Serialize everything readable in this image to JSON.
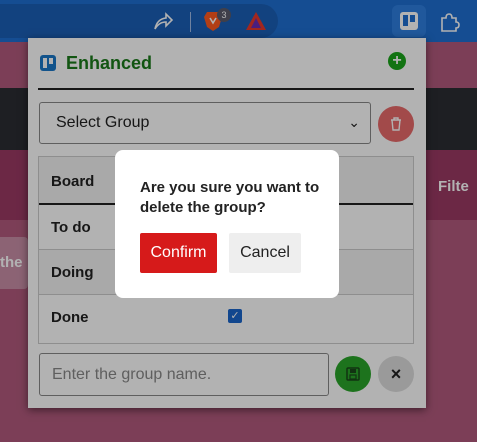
{
  "browser": {
    "badge_count": "3",
    "icons": [
      "share-icon",
      "brave-icon",
      "triangle-icon",
      "trello-icon",
      "puzzle-icon"
    ]
  },
  "page": {
    "filter_text": "Filte",
    "other_text": "the"
  },
  "popup": {
    "title": "Enhanced",
    "group_select": "Select Group",
    "table_header": "Board",
    "rows": [
      {
        "label": "To do",
        "checked": false
      },
      {
        "label": "Doing",
        "checked": false
      },
      {
        "label": "Done",
        "checked": true
      }
    ],
    "name_placeholder": "Enter the group name.",
    "close_label": "×"
  },
  "modal": {
    "message": "Are you sure you want to delete the group?",
    "confirm": "Confirm",
    "cancel": "Cancel"
  },
  "colors": {
    "title": "#1a7a1a",
    "confirm": "#d61a1a",
    "delete": "#e96a6a",
    "save": "#2aa52a"
  }
}
